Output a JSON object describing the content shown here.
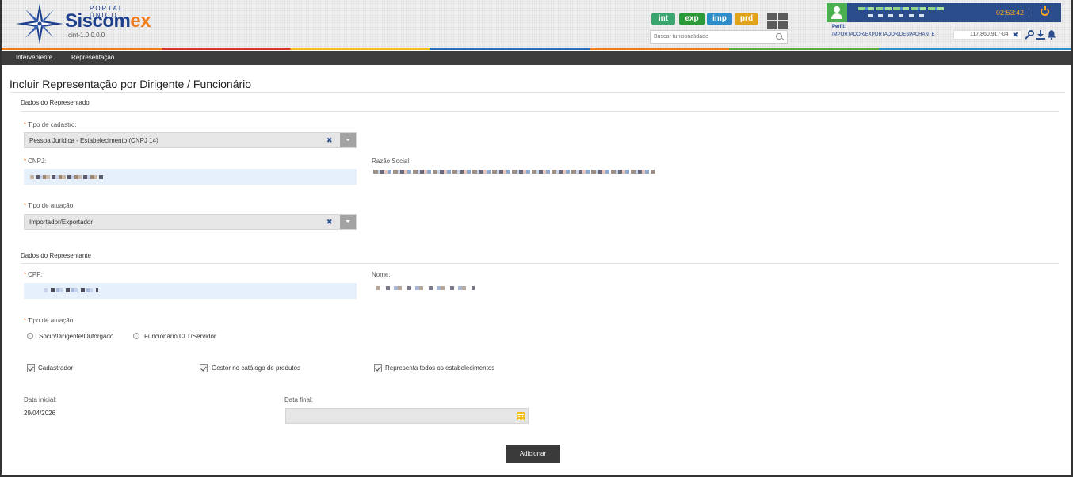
{
  "header": {
    "portal_label": "PORTAL ÚNICO",
    "brand_main": "Siscom",
    "brand_accent": "ex",
    "version": "cint-1.0.0.0.0",
    "environments": [
      "int",
      "exp",
      "imp",
      "prd"
    ],
    "search_placeholder": "Buscar funcionalidade",
    "session_time": "02:53:42",
    "perfil_label": "Perfil:",
    "perfil_value": "IMPORTADOR/EXPORTADOR/DESPACHANTE",
    "perfil_cpf": "117.860.917-04",
    "icons": [
      "user-avatar-icon",
      "power-icon",
      "key-icon",
      "download-icon",
      "bell-icon",
      "grid-apps-icon",
      "search-icon"
    ]
  },
  "nav": {
    "items": [
      "Interveniente",
      "Representação"
    ]
  },
  "page": {
    "title": "Incluir Representação por Dirigente / Funcionário"
  },
  "representado": {
    "section_title": "Dados do Representado",
    "tipo_cadastro_label": "Tipo de cadastro:",
    "tipo_cadastro_value": "Pessoa Jurídica - Estabelecimento (CNPJ 14)",
    "cnpj_label": "CNPJ:",
    "razao_social_label": "Razão Social:",
    "tipo_atuacao_label": "Tipo de atuação:",
    "tipo_atuacao_value": "Importador/Exportador"
  },
  "representante": {
    "section_title": "Dados do Representante",
    "cpf_label": "CPF:",
    "nome_label": "Nome:",
    "tipo_atuacao_label": "Tipo de atuação:",
    "radio_options": [
      "Sócio/Dirigente/Outorgado",
      "Funcionário CLT/Servidor"
    ],
    "checkboxes": [
      "Cadastrador",
      "Gestor no catálogo de produtos",
      "Representa todos os estabelecimentos"
    ],
    "data_inicial_label": "Data inicial:",
    "data_inicial_value": "29/04/2026",
    "data_final_label": "Data final:"
  },
  "actions": {
    "add_label": "Adicionar"
  },
  "symbols": {
    "required": "*",
    "clear": "✖"
  },
  "colors": {
    "brand_blue": "#1d3f8c",
    "brand_orange": "#f07c1a",
    "env_int": "#3aa56f",
    "env_exp": "#2d9a3a",
    "env_imp": "#2e8ec9",
    "env_prd": "#e0a31a",
    "nav_bg": "#3d3d3d",
    "required": "#e05a1c"
  }
}
